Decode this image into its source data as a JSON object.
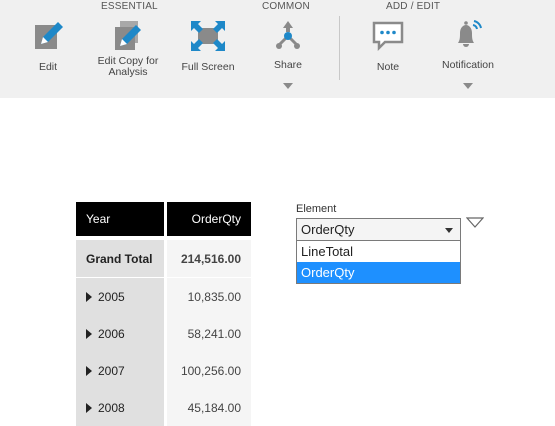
{
  "toolbar": {
    "groups": {
      "essential": "ESSENTIAL",
      "common": "COMMON",
      "add_edit": "ADD / EDIT"
    },
    "buttons": {
      "edit": "Edit",
      "edit_copy": "Edit Copy for\nAnalysis",
      "full_screen": "Full Screen",
      "share": "Share",
      "note": "Note",
      "notification": "Notification"
    }
  },
  "pivot": {
    "headers": {
      "year": "Year",
      "order_qty": "OrderQty"
    },
    "grand_total": {
      "label": "Grand Total",
      "value": "214,516.00"
    },
    "rows": [
      {
        "year": "2005",
        "value": "10,835.00"
      },
      {
        "year": "2006",
        "value": "58,241.00"
      },
      {
        "year": "2007",
        "value": "100,256.00"
      },
      {
        "year": "2008",
        "value": "45,184.00"
      }
    ]
  },
  "element_filter": {
    "label": "Element",
    "selected": "OrderQty",
    "options": [
      "LineTotal",
      "OrderQty"
    ]
  },
  "colors": {
    "toolbar_bg": "#f0f0f0",
    "icon_blue": "#1e88c8",
    "icon_gray": "#8a8a8a",
    "selected_option": "#1e90ff",
    "header_bg": "#000000"
  }
}
